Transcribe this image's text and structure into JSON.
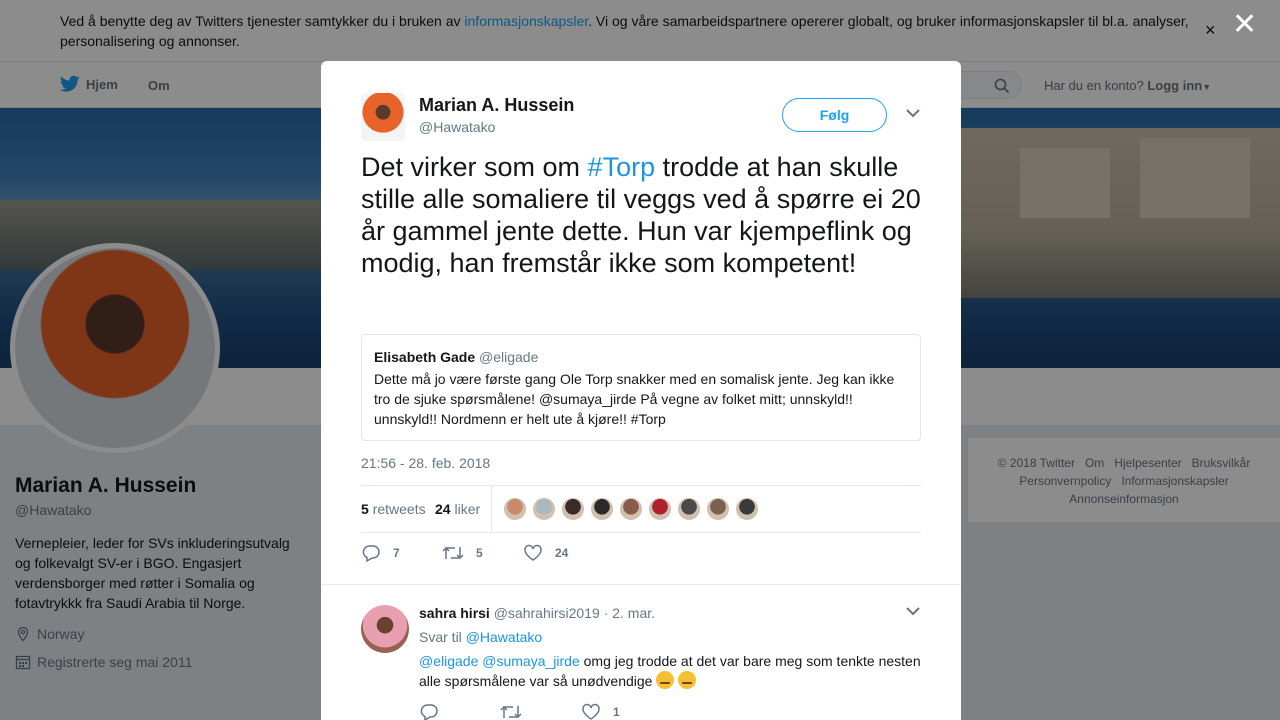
{
  "cookie_banner": {
    "text_before": "Ved å benytte deg av Twitters tjenester samtykker du i bruken av ",
    "link": "informasjonskapsler",
    "text_after": ". Vi og våre samarbeidspartnere opererer globalt, og bruker informasjonskapsler til bl.a. analyser, personalisering og annonser.",
    "close": "×"
  },
  "nav": {
    "home": "Hjem",
    "about": "Om",
    "account_prompt": "Har du en konto?",
    "login": "Logg inn"
  },
  "overlay": {
    "close": "✕"
  },
  "profile": {
    "name": "Marian A. Hussein",
    "handle": "@Hawatako",
    "bio": "Vernepleier, leder for SVs inkluderingsutvalg og folkevalgt SV-er i BGO. Engasjert verdensborger med røtter i Somalia og fotavtrykkk fra Saudi Arabia til Norge.",
    "location": "Norway",
    "joined": "Registrerte seg mai 2011"
  },
  "footer": {
    "links": [
      "© 2018 Twitter",
      "Om",
      "Hjelpesenter",
      "Bruksvilkår",
      "Personvernpolicy",
      "Informasjonskapsler",
      "Annonseinformasjon"
    ]
  },
  "tweet": {
    "author_name": "Marian A. Hussein",
    "author_handle": "@Hawatako",
    "follow_label": "Følg",
    "text_before": "Det virker som om ",
    "hashtag": "#Torp",
    "text_after": " trodde at han skulle stille alle somaliere til veggs ved å spørre ei 20 år gammel jente dette. Hun var kjempeflink og modig, han fremstår ikke som kompetent!",
    "quote": {
      "name": "Elisabeth Gade",
      "handle": "@eligade",
      "text": "Dette må jo være første gang Ole Torp snakker med en somalisk jente. Jeg kan ikke tro de sjuke spørsmålene! @sumaya_jirde På vegne av folket mitt; unnskyld!! unnskyld!! Nordmenn er helt ute å kjøre!! #Torp"
    },
    "timestamp": "21:56 - 28. feb. 2018",
    "retweets_count": "5",
    "retweets_label": "retweets",
    "likes_count": "24",
    "likes_label": "liker",
    "liker_colors": [
      "#c98a6a",
      "#aab8c2",
      "#3a2a2a",
      "#2a2a2a",
      "#8a5a4a",
      "#b0202a",
      "#4a4a4a",
      "#7a6050",
      "#3a3a3a"
    ],
    "actions": {
      "replies": "7",
      "retweets": "5",
      "likes": "24"
    }
  },
  "reply": {
    "name": "sahra hirsi",
    "handle": "@sahrahirsi2019",
    "date": "2. mar.",
    "reply_to_label": "Svar til",
    "reply_to_mention": "@Hawatako",
    "mention1": "@eligade",
    "mention2": "@sumaya_jirde",
    "text": " omg jeg trodde at det var bare meg som tenkte nesten alle spørsmålene var så unødvendige ",
    "actions": {
      "replies": "",
      "retweets": "",
      "likes": "1"
    }
  }
}
